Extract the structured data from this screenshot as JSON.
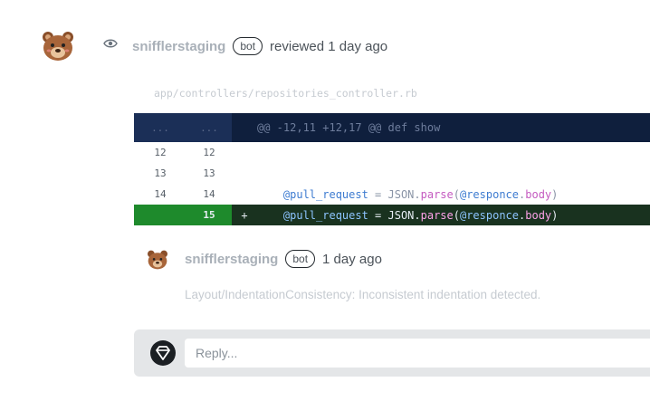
{
  "review": {
    "author": "snifflerstaging",
    "badge": "bot",
    "action": "reviewed 1 day ago",
    "avatar_icon": "bear-avatar-icon",
    "status_icon": "eye-icon"
  },
  "file": {
    "path": "app/controllers/repositories_controller.rb"
  },
  "diff": {
    "hunk": {
      "old_ln": "...",
      "new_ln": "...",
      "text": "@@ -12,11 +12,17 @@ def show"
    },
    "lines": [
      {
        "old": "12",
        "new": "12",
        "marker": "",
        "indent": "",
        "ivar": "",
        "mid": "",
        "meth": "",
        "rest": "",
        "ivar2": "",
        "dot": "",
        "meth2": "",
        "close": ""
      },
      {
        "old": "13",
        "new": "13",
        "marker": "",
        "indent": "",
        "ivar": "",
        "mid": "",
        "meth": "",
        "rest": "",
        "ivar2": "",
        "dot": "",
        "meth2": "",
        "close": ""
      },
      {
        "old": "14",
        "new": "14",
        "marker": "",
        "indent": "    ",
        "ivar": "@pull_request",
        "mid": " = JSON.",
        "meth": "parse",
        "rest": "(",
        "ivar2": "@responce",
        "dot": ".",
        "meth2": "body",
        "close": ")"
      }
    ],
    "added": {
      "old": "",
      "new": "15",
      "marker": "+",
      "indent": "    ",
      "ivar": "@pull_request",
      "mid": " = JSON.",
      "meth": "parse",
      "rest": "(",
      "ivar2": "@responce",
      "dot": ".",
      "meth2": "body",
      "close": ")"
    }
  },
  "comment": {
    "author": "snifflerstaging",
    "badge": "bot",
    "time": "1 day ago",
    "body": "Layout/IndentationConsistency: Inconsistent indentation detected."
  },
  "reply": {
    "placeholder": "Reply...",
    "icon": "gem-logo-icon"
  },
  "colors": {
    "hunk_bg": "#0f1f3d",
    "added_bg": "#19321f",
    "added_gutter": "#1e8a2c"
  }
}
